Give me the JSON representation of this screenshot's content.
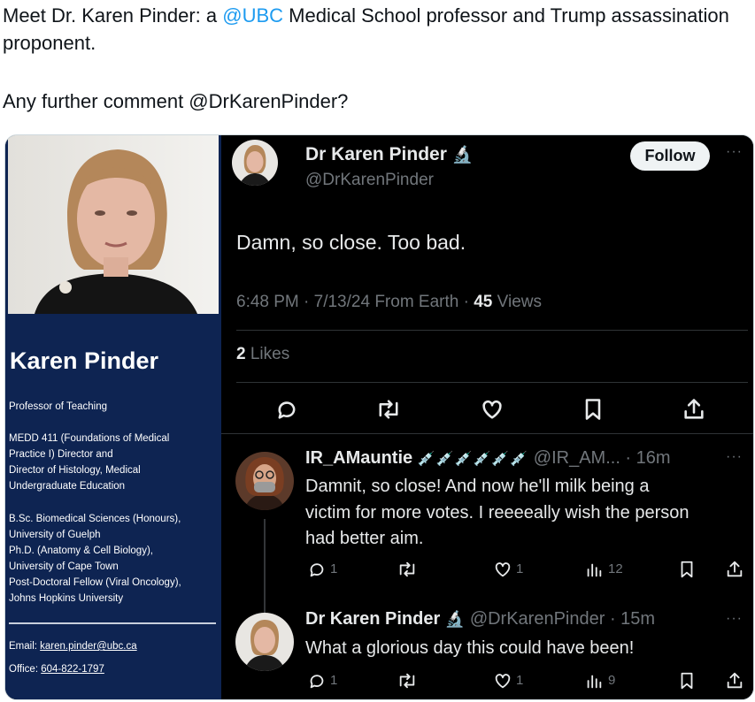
{
  "post": {
    "line1_pre": "Meet Dr. Karen Pinder:  a ",
    "mention_ubc": "@UBC",
    "line1_post": " Medical School professor and Trump assassination proponent.",
    "line2": "Any further comment @DrKarenPinder?"
  },
  "card": {
    "name": "Karen Pinder",
    "title": "Professor of Teaching",
    "role": [
      "MEDD 411 (Foundations of Medical",
      "Practice I) Director and",
      "Director of Histology, Medical",
      "Undergraduate Education"
    ],
    "education": [
      "B.Sc. Biomedical Sciences (Honours),",
      "University of Guelph",
      "Ph.D. (Anatomy & Cell Biology),",
      "University of Cape Town",
      "Post-Doctoral Fellow (Viral Oncology),",
      "Johns Hopkins University"
    ],
    "email_label": "Email: ",
    "email": "karen.pinder@ubc.ca",
    "office_label": "Office: ",
    "office": "604-822-1797"
  },
  "main_tweet": {
    "display_name": "Dr Karen Pinder",
    "badge_emoji": "🔬",
    "handle": "@DrKarenPinder",
    "follow_label": "Follow",
    "more": "···",
    "text": "Damn, so close. Too bad.",
    "meta_time": "6:48 PM · 7/13/24 From Earth · ",
    "views_count": "45",
    "views_label": " Views",
    "likes_count": "2",
    "likes_label": " Likes"
  },
  "replies": [
    {
      "display_name": "IR_AMauntie",
      "badge_emoji": "💉💉💉💉💉💉",
      "handle_time": "@IR_AM... · 16m",
      "more": "···",
      "text": [
        "Damnit, so close! And now he'll milk being a",
        "victim for more votes. I reeeeally wish the person",
        "had better aim."
      ],
      "reply_count": "1",
      "like_count": "1",
      "view_count": "12"
    },
    {
      "display_name": "Dr Karen Pinder",
      "badge_emoji": "🔬",
      "handle_time": "@DrKarenPinder · 15m",
      "more": "···",
      "text": [
        "What a glorious day this could have been!"
      ],
      "reply_count": "1",
      "like_count": "1",
      "view_count": "9"
    }
  ],
  "colors": {
    "mention": "#1d9bf0",
    "card_bg": "#0e2452",
    "tw_bg": "#000000",
    "dim": "#71767b"
  }
}
